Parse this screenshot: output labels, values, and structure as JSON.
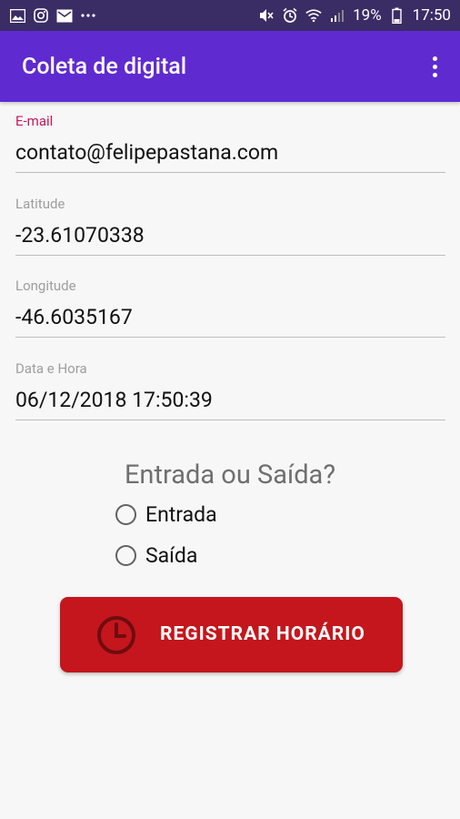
{
  "status_bar": {
    "battery": "19%",
    "time": "17:50"
  },
  "app_bar": {
    "title": "Coleta de digital",
    "menu_icon": "more-vert-icon"
  },
  "form": {
    "email": {
      "label": "E-mail",
      "value": "contato@felipepastana.com"
    },
    "latitude": {
      "label": "Latitude",
      "value": "-23.61070338"
    },
    "longitude": {
      "label": "Longitude",
      "value": "-46.6035167"
    },
    "datetime": {
      "label": "Data e Hora",
      "value": "06/12/2018 17:50:39"
    }
  },
  "entry_type": {
    "question": "Entrada ou Saída?",
    "options": [
      {
        "label": "Entrada",
        "selected": false
      },
      {
        "label": "Saída",
        "selected": false
      }
    ]
  },
  "register_button": {
    "label": "REGISTRAR HORÁRIO",
    "icon": "clock-icon",
    "color": "#c4161c"
  },
  "colors": {
    "status_bar": "#3a2d66",
    "app_bar": "#5f2bd0",
    "accent_label": "#c2185b"
  }
}
